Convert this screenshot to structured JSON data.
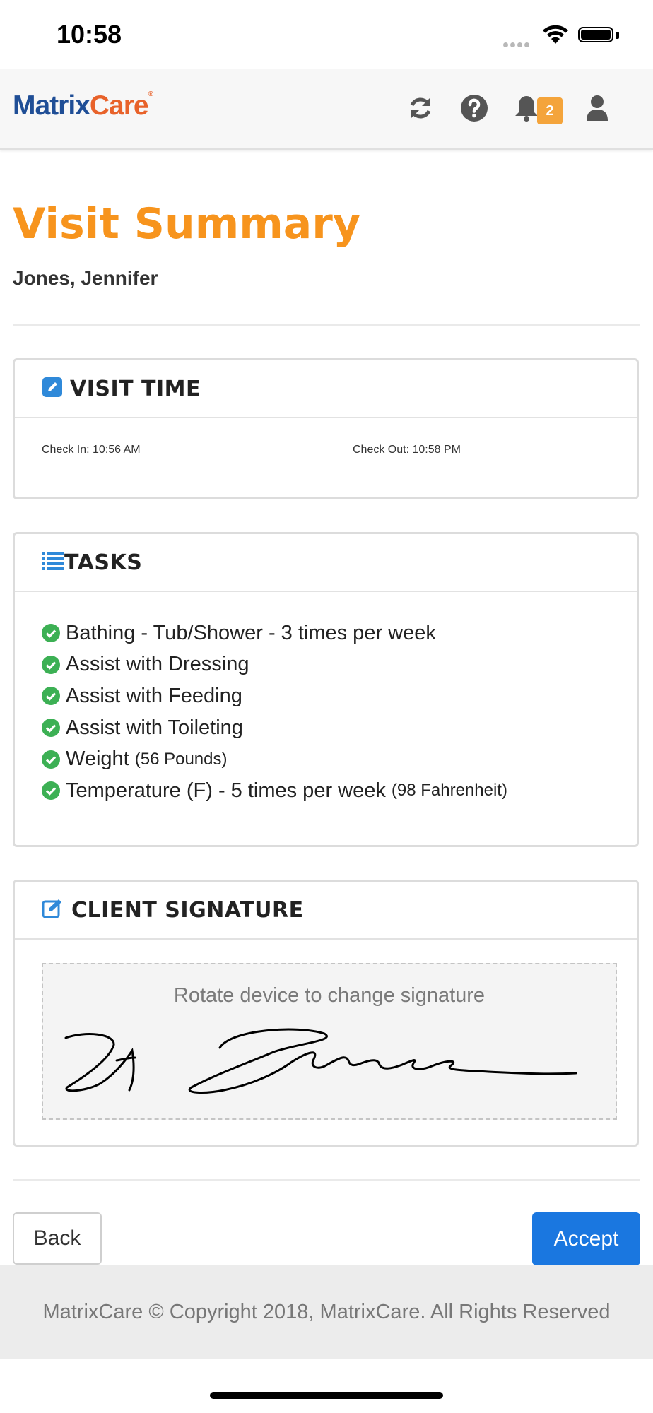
{
  "status_bar": {
    "time": "10:58"
  },
  "header": {
    "logo_part1": "Matrix",
    "logo_part2": "Care",
    "logo_mark": "®",
    "notification_count": "2",
    "icons": [
      "refresh-icon",
      "help-icon",
      "bell-icon",
      "user-icon"
    ]
  },
  "page": {
    "title": "Visit Summary",
    "client_name": "Jones, Jennifer"
  },
  "visit_time": {
    "heading": "VISIT TIME",
    "check_in": "Check In: 10:56 AM",
    "check_out": "Check Out: 10:58 PM"
  },
  "tasks": {
    "heading": "TASKS",
    "items": [
      {
        "label": "Bathing - Tub/Shower - 3 times per week",
        "detail": ""
      },
      {
        "label": "Assist with Dressing",
        "detail": ""
      },
      {
        "label": "Assist with Feeding",
        "detail": ""
      },
      {
        "label": "Assist with Toileting",
        "detail": ""
      },
      {
        "label": "Weight",
        "detail": "(56 Pounds)"
      },
      {
        "label": "Temperature (F) - 5 times per week",
        "detail": "(98 Fahrenheit)"
      }
    ]
  },
  "signature": {
    "heading": "CLIENT SIGNATURE",
    "hint": "Rotate device to change signature",
    "signed_text": "J Jones"
  },
  "actions": {
    "back_label": "Back",
    "accept_label": "Accept"
  },
  "footer": {
    "text": "MatrixCare © Copyright 2018, MatrixCare. All Rights Reserved"
  },
  "colors": {
    "title_orange": "#f7941d",
    "accept_blue": "#1a77e0",
    "check_green": "#3cb054",
    "badge_orange": "#f4a43b",
    "logo_blue": "#1f4e96",
    "logo_orange": "#e8622a"
  }
}
